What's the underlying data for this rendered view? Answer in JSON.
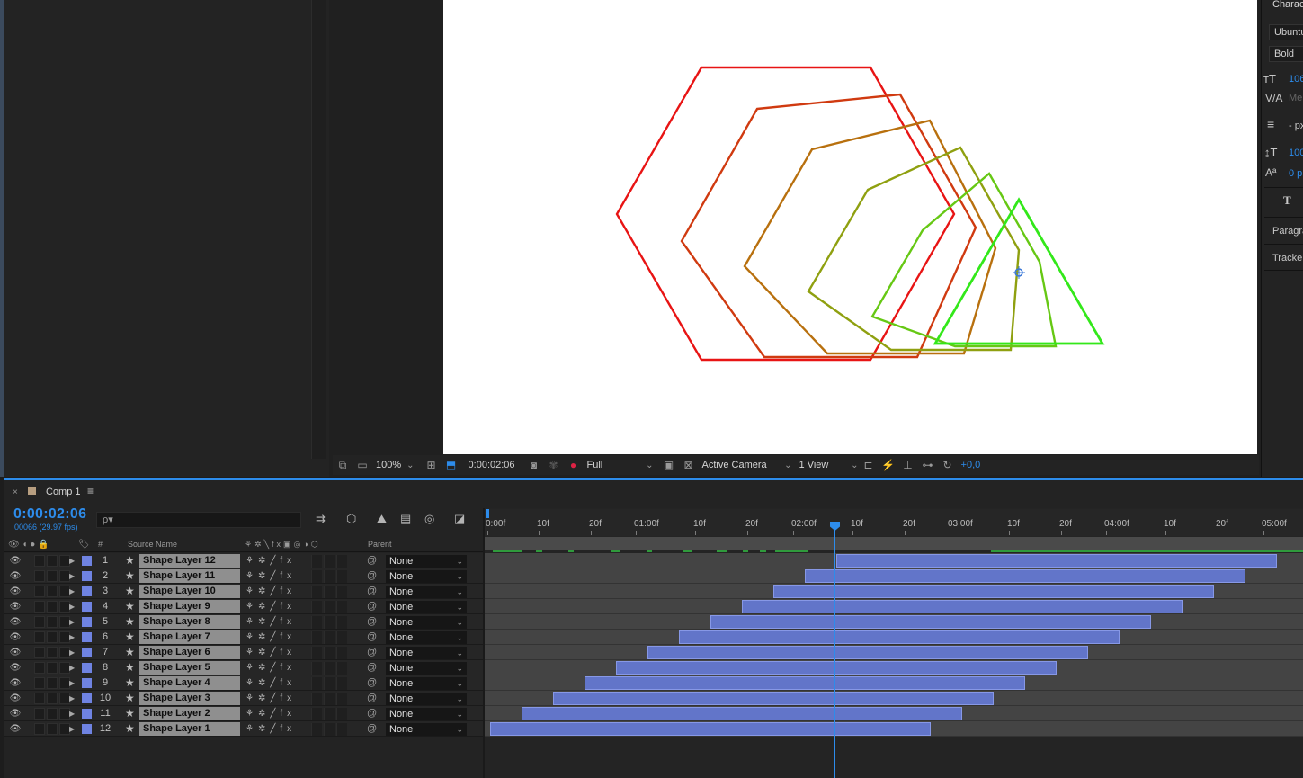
{
  "viewer": {
    "zoom": "100%",
    "timecode": "0:00:02:06",
    "resolution": "Full",
    "camera": "Active Camera",
    "views": "1 View",
    "exposure": "+0,0"
  },
  "character_panel": {
    "title": "Charac",
    "font": "Ubuntu",
    "style": "Bold",
    "size": "106",
    "kerning": "Me",
    "stroke": "- px",
    "vscale": "100",
    "baseline": "0 p",
    "paragraph_label": "Paragra",
    "tracker_label": "Tracker"
  },
  "timeline": {
    "tab_title": "Comp 1",
    "close": "×",
    "menu": "≡",
    "timecode": "0:00:02:06",
    "frame_info": "00066 (29.97 fps)",
    "search_placeholder": "ρ▾",
    "headers": {
      "num": "#",
      "source_name": "Source Name",
      "parent": "Parent"
    },
    "ruler_labels": [
      "0:00f",
      "10f",
      "20f",
      "01:00f",
      "10f",
      "20f",
      "02:00f",
      "10f",
      "20f",
      "03:00f",
      "10f",
      "20f",
      "04:00f",
      "10f",
      "20f",
      "05:00f"
    ],
    "layers": [
      {
        "num": "1",
        "name": "Shape Layer 12",
        "parent": "None",
        "in": 2.2,
        "out": 5.0
      },
      {
        "num": "2",
        "name": "Shape Layer 11",
        "parent": "None",
        "in": 2.0,
        "out": 4.8
      },
      {
        "num": "3",
        "name": "Shape Layer 10",
        "parent": "None",
        "in": 1.8,
        "out": 4.6
      },
      {
        "num": "4",
        "name": "Shape Layer 9",
        "parent": "None",
        "in": 1.6,
        "out": 4.4
      },
      {
        "num": "5",
        "name": "Shape Layer 8",
        "parent": "None",
        "in": 1.4,
        "out": 4.2
      },
      {
        "num": "6",
        "name": "Shape Layer 7",
        "parent": "None",
        "in": 1.2,
        "out": 4.0
      },
      {
        "num": "7",
        "name": "Shape Layer 6",
        "parent": "None",
        "in": 1.0,
        "out": 3.8
      },
      {
        "num": "8",
        "name": "Shape Layer 5",
        "parent": "None",
        "in": 0.8,
        "out": 3.6
      },
      {
        "num": "9",
        "name": "Shape Layer 4",
        "parent": "None",
        "in": 0.6,
        "out": 3.4
      },
      {
        "num": "10",
        "name": "Shape Layer 3",
        "parent": "None",
        "in": 0.4,
        "out": 3.2
      },
      {
        "num": "11",
        "name": "Shape Layer 2",
        "parent": "None",
        "in": 0.2,
        "out": 3.0
      },
      {
        "num": "12",
        "name": "Shape Layer 1",
        "parent": "None",
        "in": 0.0,
        "out": 2.8
      }
    ]
  },
  "colors": {
    "accent": "#2d8ceb",
    "layer_bar": "#6275c9",
    "shapes": [
      "#e81414",
      "#d03a10",
      "#b8700e",
      "#8fa010",
      "#66c814",
      "#33e81a"
    ]
  },
  "icons": {
    "eye": "eye-icon",
    "star": "shape-star-icon",
    "twirl": "twirl-triangle-icon",
    "parent_pick": "pickwhip-icon"
  }
}
